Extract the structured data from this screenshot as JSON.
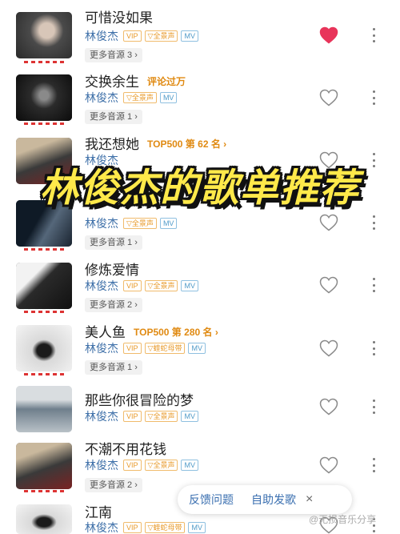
{
  "overlay": {
    "title": "林俊杰的歌单推荐"
  },
  "songs": [
    {
      "title": "可惜没如果",
      "tag": "",
      "artist": "林俊杰",
      "vip": "VIP",
      "quality": "全景声",
      "mv": "MV",
      "more": "更多音源 3",
      "liked": true
    },
    {
      "title": "交换余生",
      "tag": "评论过万",
      "artist": "林俊杰",
      "vip": "",
      "quality": "全景声",
      "mv": "MV",
      "more": "更多音源 1",
      "liked": false
    },
    {
      "title": "我还想她",
      "tag": "TOP500 第 62 名",
      "artist": "林俊杰",
      "vip": "",
      "quality": "",
      "mv": "",
      "more": "",
      "liked": false
    },
    {
      "title": "",
      "tag": "",
      "artist": "林俊杰",
      "vip": "",
      "quality": "全景声",
      "mv": "MV",
      "more": "更多音源 1",
      "liked": false
    },
    {
      "title": "修炼爱情",
      "tag": "",
      "artist": "林俊杰",
      "vip": "VIP",
      "quality": "全景声",
      "mv": "MV",
      "more": "更多音源 2",
      "liked": false
    },
    {
      "title": "美人鱼",
      "tag": "TOP500 第 280 名",
      "artist": "林俊杰",
      "vip": "VIP",
      "quality": "蝰蛇母带",
      "mv": "MV",
      "more": "更多音源 1",
      "liked": false
    },
    {
      "title": "那些你很冒险的梦",
      "tag": "",
      "artist": "林俊杰",
      "vip": "VIP",
      "quality": "全景声",
      "mv": "MV",
      "more": "",
      "liked": false
    },
    {
      "title": "不潮不用花钱",
      "tag": "",
      "artist": "林俊杰",
      "vip": "VIP",
      "quality": "全景声",
      "mv": "MV",
      "more": "更多音源 2",
      "liked": false
    },
    {
      "title": "江南",
      "tag": "",
      "artist": "林俊杰",
      "vip": "VIP",
      "quality": "蝰蛇母带",
      "mv": "MV",
      "more": "",
      "liked": false
    }
  ],
  "feedback": {
    "report": "反馈问题",
    "self_help": "自助发歌",
    "close": "×"
  },
  "watermark": "@无损音乐分享",
  "colors": {
    "liked_heart": "#e8345a",
    "link_blue": "#3d6fa8",
    "accent_orange": "#e08a12",
    "overlay_yellow": "#ffe94a"
  }
}
